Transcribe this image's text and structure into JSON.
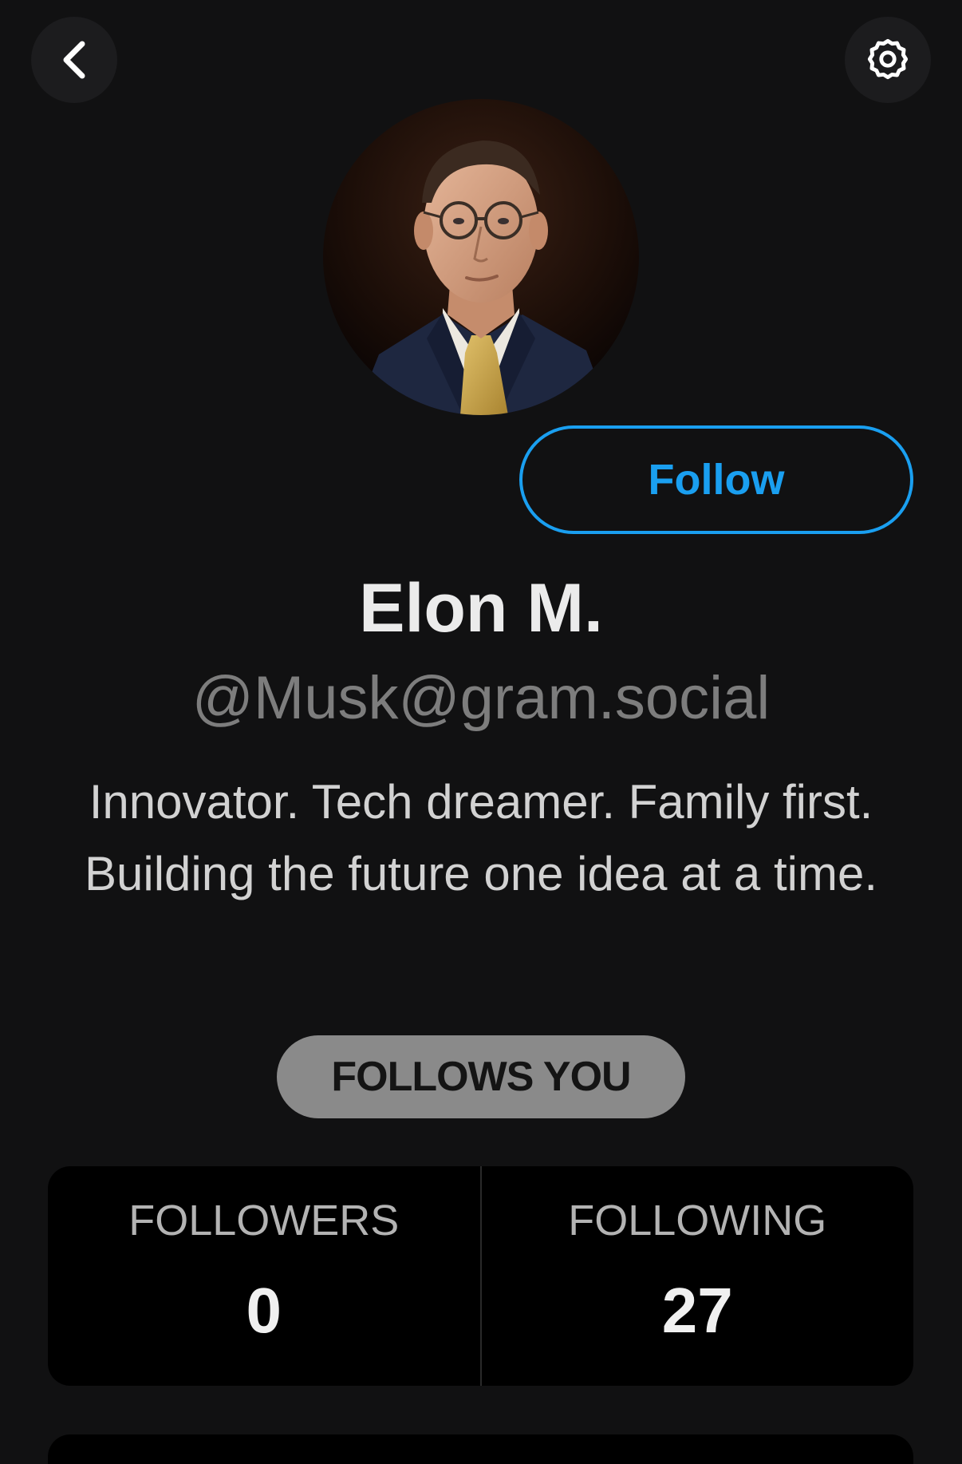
{
  "header": {
    "back_icon": "chevron-left-icon",
    "settings_icon": "gear-icon"
  },
  "profile": {
    "display_name": "Elon M.",
    "handle": "@Musk@gram.social",
    "bio": "Innovator. Tech dreamer. Family first. Building the future one idea at a time.",
    "follow_label": "Follow",
    "follows_you_label": "FOLLOWS YOU"
  },
  "stats": {
    "followers_label": "FOLLOWERS",
    "followers_value": "0",
    "following_label": "FOLLOWING",
    "following_value": "27"
  },
  "colors": {
    "background": "#111112",
    "accent": "#1a9ff0",
    "badge": "#8a8a8a",
    "card": "#000000"
  }
}
